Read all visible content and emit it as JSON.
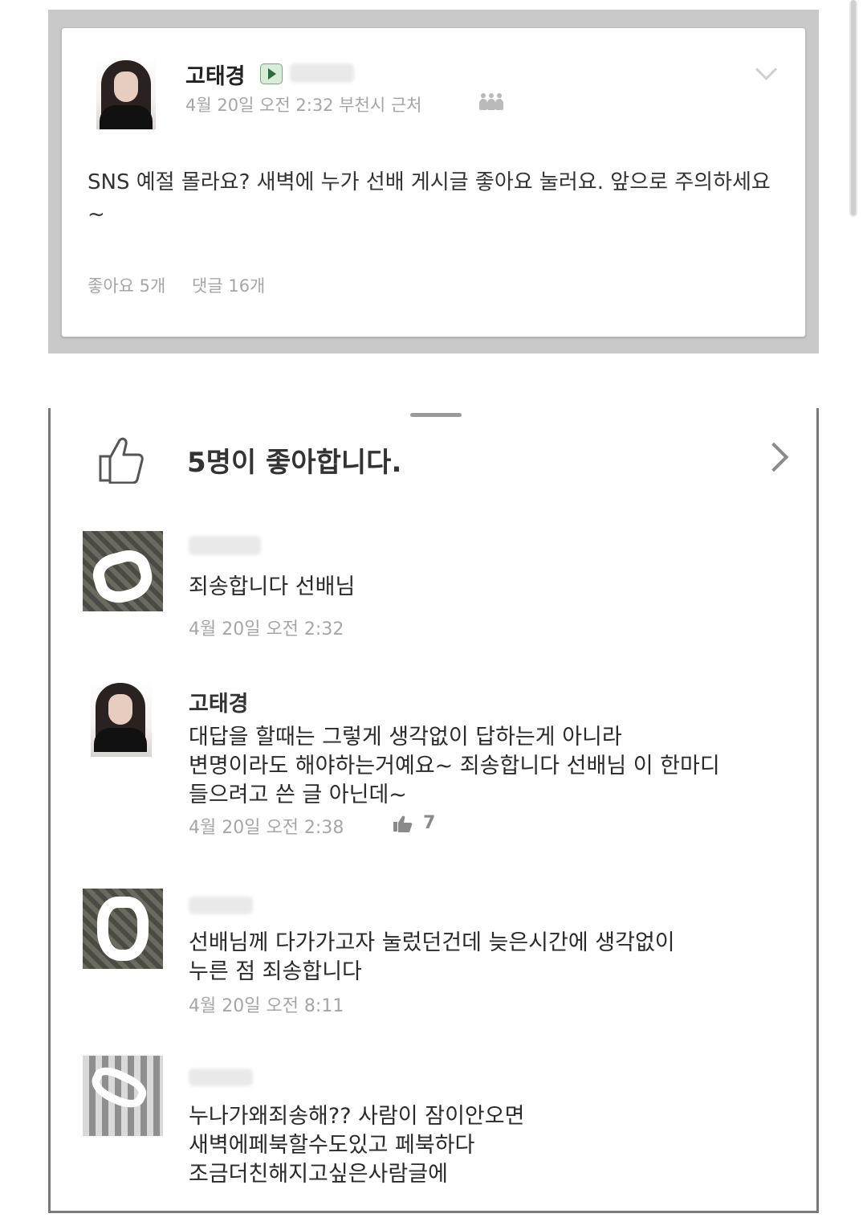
{
  "post": {
    "author": "고태경",
    "meta": "4월 20일 오전 2:32 부천시 근처",
    "text": "SNS 예절 몰라요? 새벽에 누가 선배 게시글 좋아요 눌러요. 앞으로 주의하세요~",
    "likes": "좋아요 5개",
    "comments": "댓글 16개"
  },
  "panel": {
    "likes_summary": "5명이 좋아합니다."
  },
  "comments": [
    {
      "name": "",
      "text": "죄송합니다 선배님",
      "time": "4월 20일 오전 2:32"
    },
    {
      "name": "고태경",
      "text": "대답을 할때는 그렇게 생각없이 답하는게 아니라\n변명이라도 해야하는거예요~ 죄송합니다 선배님 이 한마디\n들으려고 쓴 글 아닌데~",
      "time": "4월 20일 오전 2:38",
      "like_count": "7"
    },
    {
      "name": "",
      "text": "선배님께 다가가고자 눌렀던건데 늦은시간에 생각없이\n누른 점 죄송합니다",
      "time": "4월 20일 오전 8:11"
    },
    {
      "name": "",
      "text": "누나가왜죄송해?? 사람이 잠이안오면\n새벽에페북할수도있고 페북하다\n조금더친해지고싶은사람글에",
      "time": ""
    }
  ],
  "icons": {
    "verified": "play-badge-icon",
    "location_people": "people-icon",
    "menu": "chevron-down-icon",
    "like": "thumbs-up-icon",
    "more": "chevron-right-icon"
  }
}
